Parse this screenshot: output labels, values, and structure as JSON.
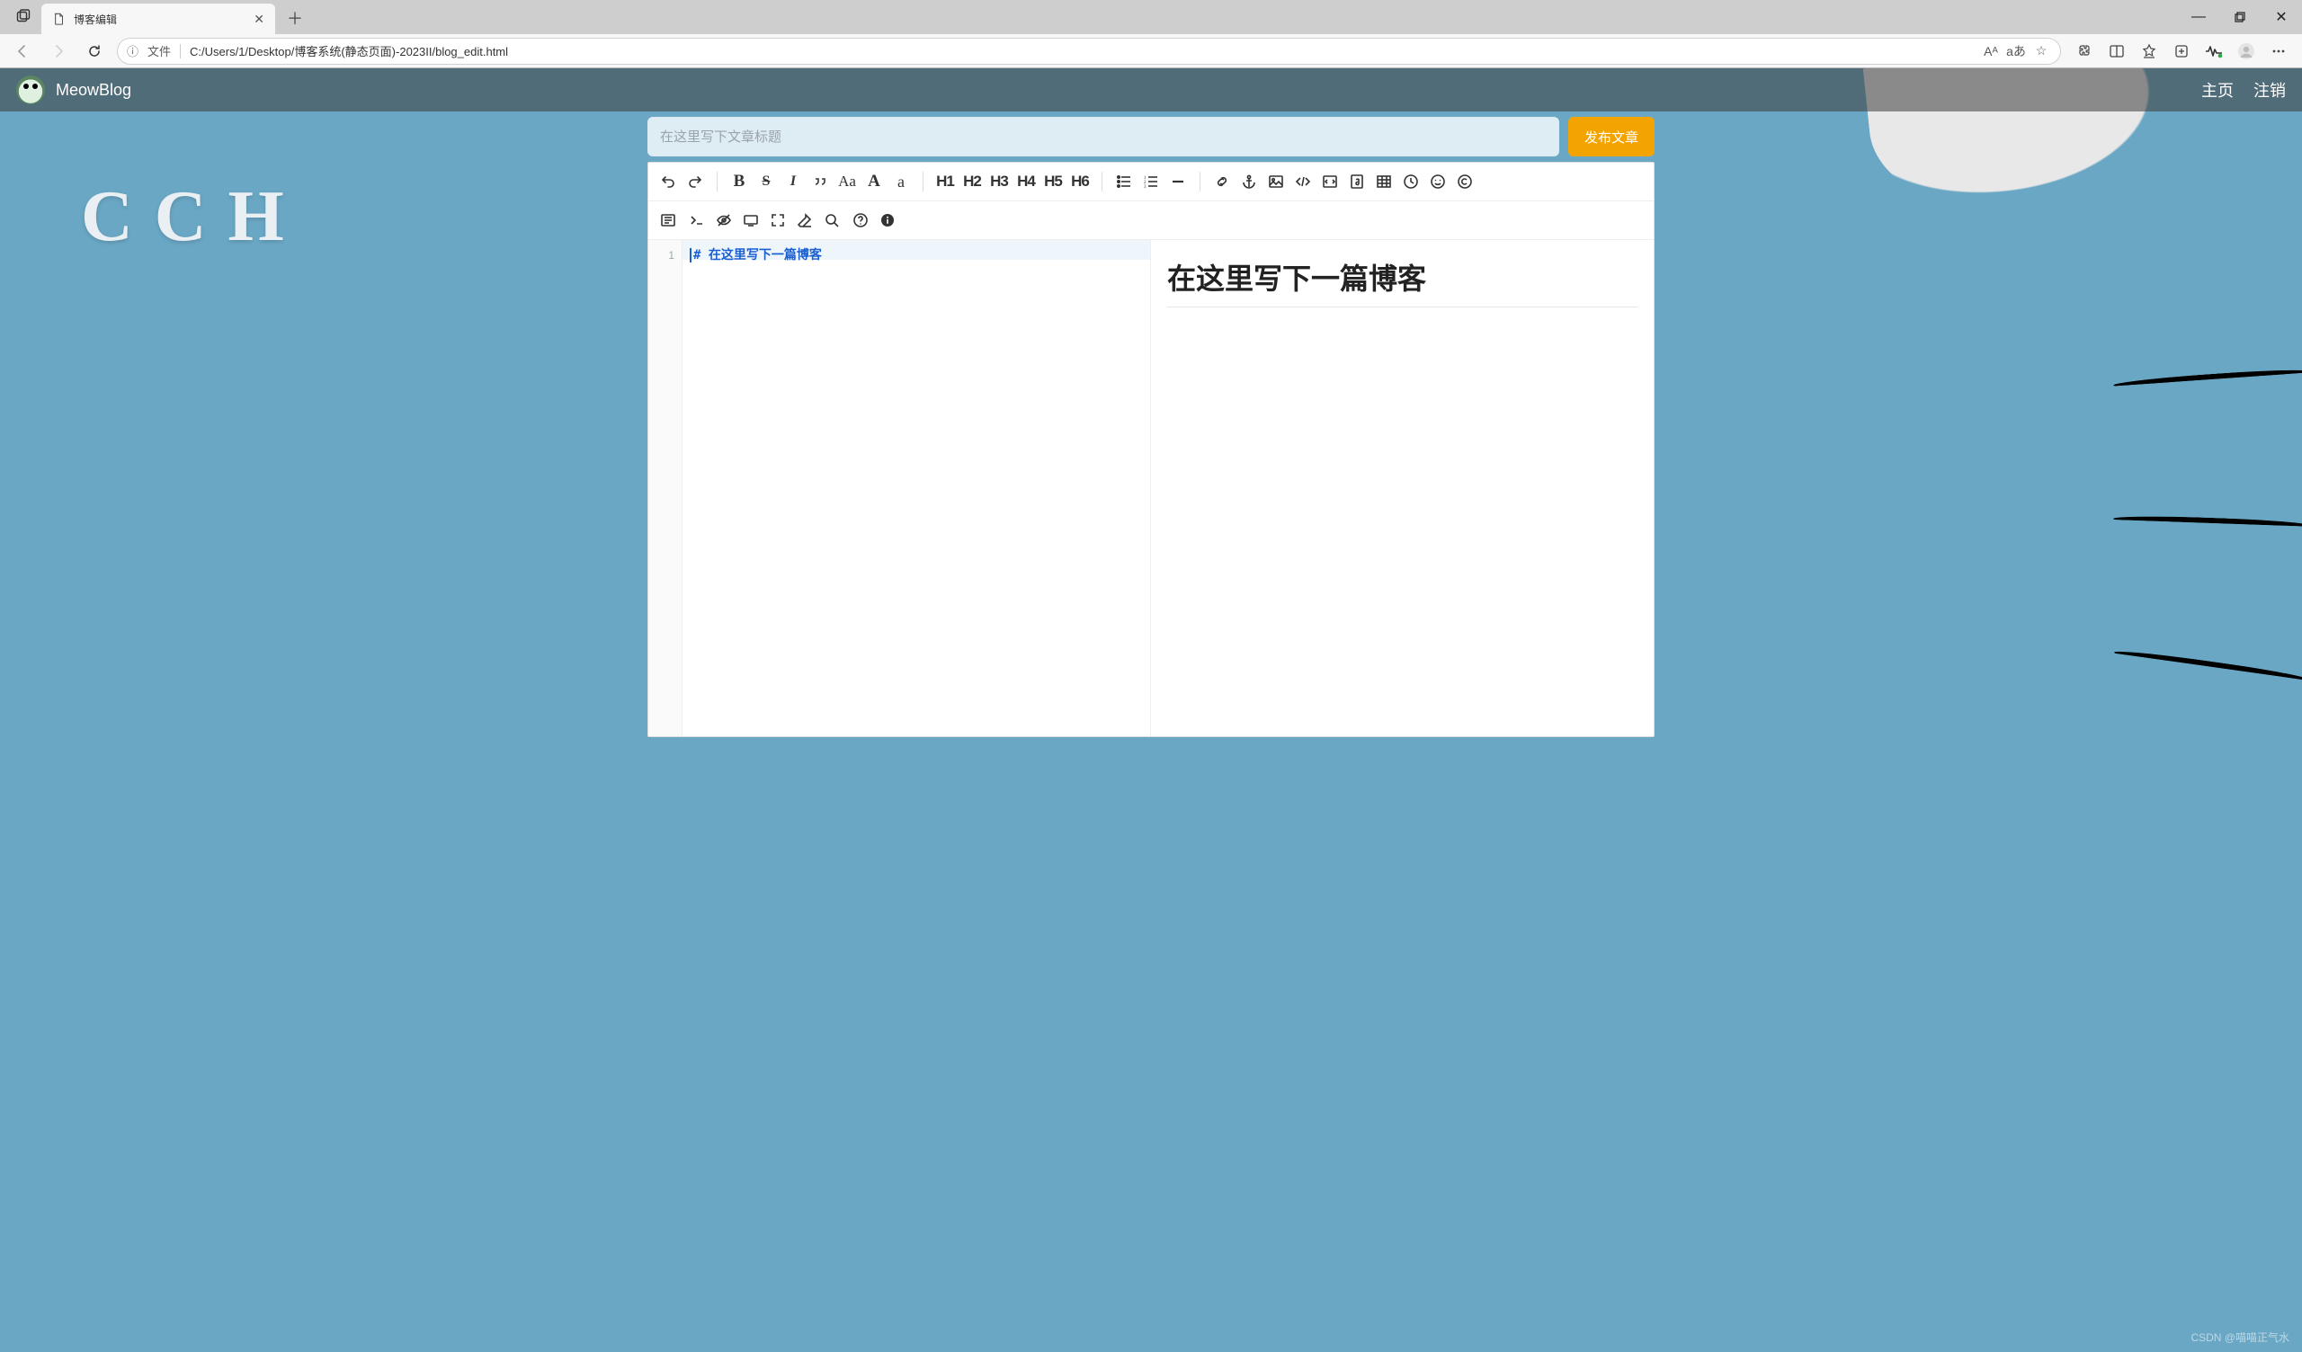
{
  "browser": {
    "tab_title": "博客编辑",
    "window_controls": {
      "min": "—",
      "max": "▢",
      "close": "✕"
    },
    "address": {
      "label": "文件",
      "url": "C:/Users/1/Desktop/博客系统(静态页面)-2023II/blog_edit.html"
    },
    "addr_icons": [
      "Aᴬ",
      "aあ",
      "☆"
    ],
    "right_icons": [
      "puzzle-icon",
      "sidebar-icon",
      "favorites-icon",
      "collections-icon",
      "heartbeat-icon",
      "profile-icon",
      "more-icon"
    ]
  },
  "site": {
    "title": "MeowBlog",
    "nav": {
      "home": "主页",
      "logout": "注销"
    }
  },
  "compose": {
    "title_placeholder": "在这里写下文章标题",
    "publish_label": "发布文章"
  },
  "editor": {
    "headings": [
      "H1",
      "H2",
      "H3",
      "H4",
      "H5",
      "H6"
    ],
    "source_line_no": "1",
    "source_hash": "#",
    "source_text": "在这里写下一篇博客",
    "preview_heading": "在这里写下一篇博客"
  },
  "bg_text": "C           C              H",
  "watermark": "CSDN @喵喵正气水"
}
